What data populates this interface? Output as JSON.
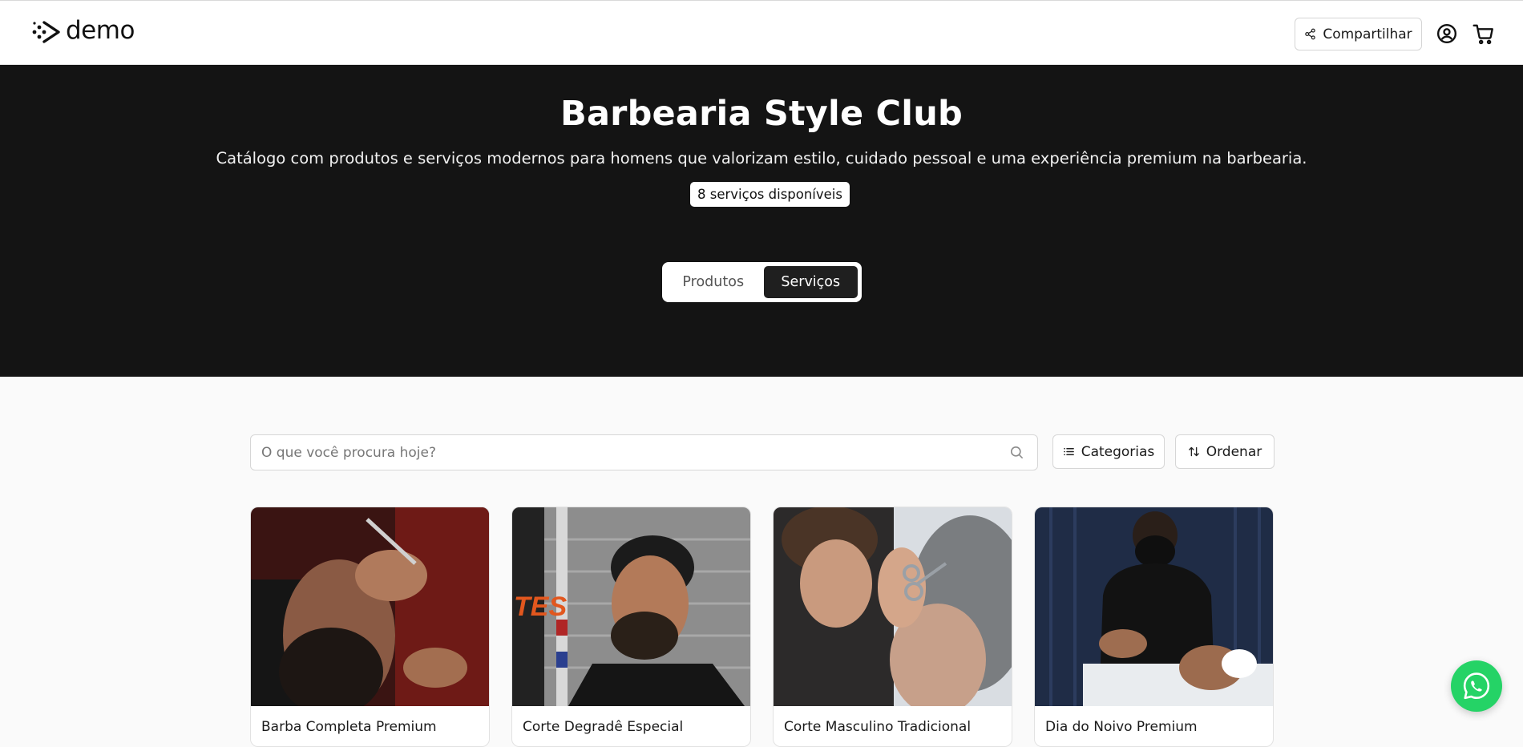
{
  "header": {
    "logo_text": "demo",
    "share_label": "Compartilhar",
    "icons": [
      "share-icon",
      "user-icon",
      "cart-icon"
    ]
  },
  "hero": {
    "title": "Barbearia Style Club",
    "subtitle": "Catálogo com produtos e serviços modernos para homens que valorizam estilo, cuidado pessoal e uma experiência premium na barbearia.",
    "badge": "8 serviços disponíveis",
    "tabs": [
      {
        "label": "Produtos",
        "active": false
      },
      {
        "label": "Serviços",
        "active": true
      }
    ]
  },
  "search": {
    "placeholder": "O que você procura hoje?",
    "value": ""
  },
  "filters": {
    "categories_label": "Categorias",
    "sort_label": "Ordenar"
  },
  "cards": [
    {
      "title": "Barba Completa Premium"
    },
    {
      "title": "Corte Degradê Especial"
    },
    {
      "title": "Corte Masculino Tradicional"
    },
    {
      "title": "Dia do Noivo Premium"
    }
  ],
  "colors": {
    "hero_bg": "#141414",
    "whatsapp": "#25d366",
    "active_tab": "#1f1f1f"
  }
}
